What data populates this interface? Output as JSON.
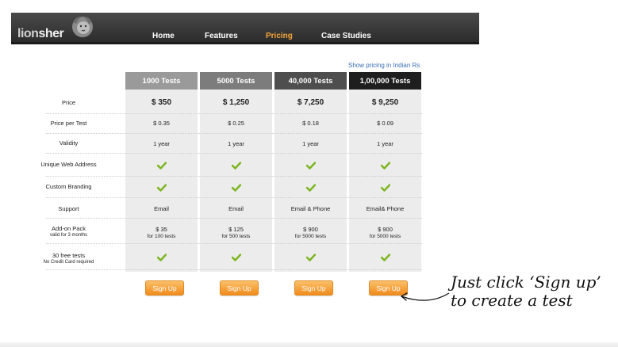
{
  "logo": {
    "text_part1": "lion",
    "text_part2": "sher"
  },
  "nav": {
    "items": [
      {
        "label": "Home"
      },
      {
        "label": "Features"
      },
      {
        "label": "Pricing",
        "active": true
      },
      {
        "label": "Case Studies"
      }
    ]
  },
  "indian_pricing_link": "Show pricing in Indian Rs",
  "plans": [
    {
      "name": "1000 Tests",
      "header_color": "#9a9a9a",
      "price": "$ 350",
      "per_test": "$ 0.35",
      "validity": "1 year",
      "support": "Email",
      "addon_price": "$ 35",
      "addon_sub": "for 100 tests",
      "signup": "Sign Up"
    },
    {
      "name": "5000 Tests",
      "header_color": "#7c7c7c",
      "price": "$ 1,250",
      "per_test": "$ 0.25",
      "validity": "1 year",
      "support": "Email",
      "addon_price": "$ 125",
      "addon_sub": "for 500 tests",
      "signup": "Sign Up"
    },
    {
      "name": "40,000 Tests",
      "header_color": "#4e4e4e",
      "price": "$ 7,250",
      "per_test": "$ 0.18",
      "validity": "1 year",
      "support": "Email & Phone",
      "addon_price": "$ 900",
      "addon_sub": "for 5000 tests",
      "signup": "Sign Up"
    },
    {
      "name": "1,00,000 Tests",
      "header_color": "#1e1e1e",
      "price": "$ 9,250",
      "per_test": "$ 0.09",
      "validity": "1 year",
      "support": "Email& Phone",
      "addon_price": "$ 900",
      "addon_sub": "for 5000 tests",
      "signup": "Sign Up"
    }
  ],
  "rows": {
    "price": "Price",
    "per_test": "Price per Test",
    "validity": "Validity",
    "web_address": "Unique Web Address",
    "branding": "Custom Branding",
    "support": "Support",
    "addon": "Add-on Pack",
    "addon_sub": "valid for 3 months",
    "free_tests": "30 free tests",
    "free_tests_sub": "No Credit Card required"
  },
  "annotation": {
    "line1": "Just click ‘Sign up’",
    "line2": "to create a test"
  },
  "colors": {
    "accent": "#f6a63a",
    "check": "#7ab51d",
    "link": "#3a6fb2"
  }
}
